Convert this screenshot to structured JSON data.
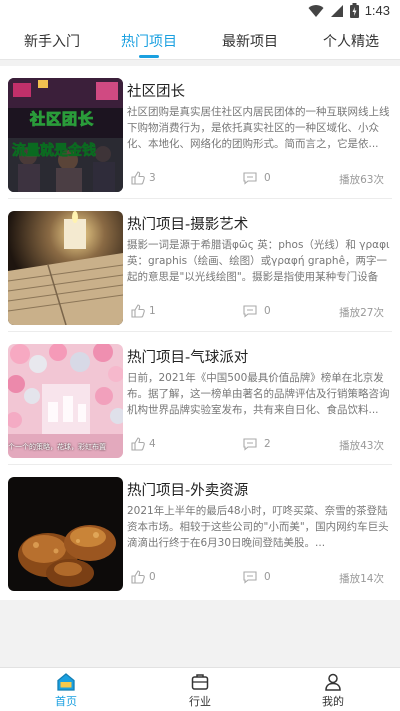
{
  "status_bar": {
    "time": "1:43",
    "icons": [
      "wifi-icon",
      "signal-icon",
      "battery-icon"
    ]
  },
  "tabs": [
    {
      "label": "新手入门",
      "active": false
    },
    {
      "label": "热门项目",
      "active": true
    },
    {
      "label": "最新项目",
      "active": false
    },
    {
      "label": "个人精选",
      "active": false
    }
  ],
  "accent_color": "#1aa0e0",
  "items": [
    {
      "title": "社区团长",
      "thumb_text_top": "社区团长",
      "thumb_text_bottom": "流量就是金钱",
      "description": "社区团购是真实居住社区内居民团体的一种互联网线上线下购物消费行为，是依托真实社区的一种区域化、小众化、本地化、网络化的团购形式。简而言之，它是依...",
      "likes": "3",
      "comments": "0",
      "views": "播放63次"
    },
    {
      "title": "热门项目-摄影艺术",
      "description": "摄影一词是源于希腊语φῶς 英：phos（光线）和 γραφι 英：graphis（绘画、绘图）或γραφή graphê，两字一起的意思是\"以光线绘图\"。摄影是指使用某种专门设备进...",
      "likes": "1",
      "comments": "0",
      "views": "播放27次"
    },
    {
      "title": "热门项目-气球派对",
      "thumb_caption": "个一个的策略，花球，彩虹布置",
      "description": "日前，2021年《中国500最具价值品牌》榜单在北京发布。据了解，这一榜单由著名的品牌评估及行销策略咨询机构世界品牌实验室发布，共有来自日化、食品饮料...",
      "likes": "4",
      "comments": "2",
      "views": "播放43次"
    },
    {
      "title": "热门项目-外卖资源",
      "description": "2021年上半年的最后48小时，叮咚买菜、奈雪的茶登陆资本市场。相较于这些公司的\"小而美\"，国内网约车巨头滴滴出行终于在6月30日晚间登陆美股。...",
      "likes": "0",
      "comments": "0",
      "views": "播放14次"
    }
  ],
  "bottom_nav": [
    {
      "label": "首页",
      "icon": "home-icon",
      "active": true
    },
    {
      "label": "行业",
      "icon": "briefcase-icon",
      "active": false
    },
    {
      "label": "我的",
      "icon": "user-icon",
      "active": false
    }
  ]
}
